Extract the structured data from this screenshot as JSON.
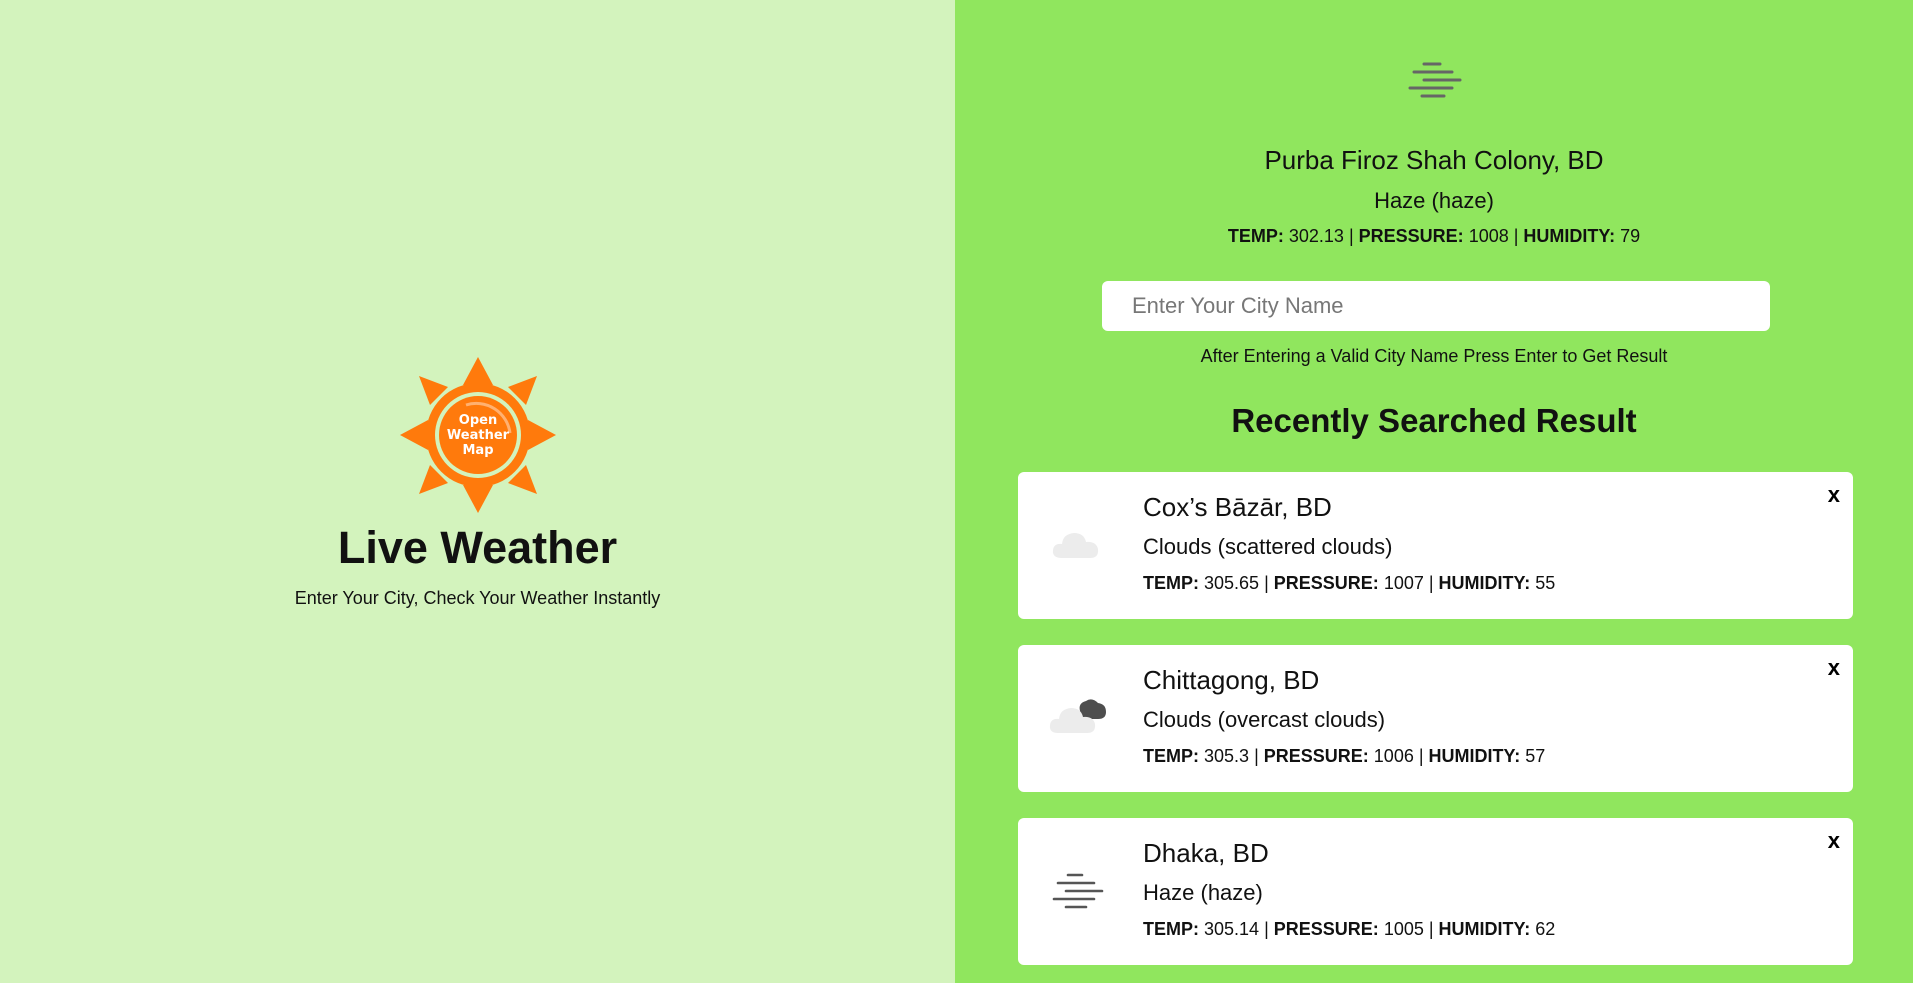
{
  "brand": {
    "logo_text": "Open Weather Map",
    "title": "Live Weather",
    "tagline": "Enter Your City, Check Your Weather Instantly"
  },
  "current": {
    "icon": "haze-icon",
    "city": "Purba Firoz Shah Colony, BD",
    "main": "Haze",
    "description": "haze",
    "temp": "302.13",
    "pressure": "1008",
    "humidity": "79"
  },
  "labels": {
    "temp": "TEMP:",
    "pressure": "PRESSURE:",
    "humidity": "HUMIDITY:",
    "sep": " | "
  },
  "search": {
    "placeholder": "Enter Your City Name",
    "value": "",
    "hint": "After Entering a Valid City Name Press Enter to Get Result"
  },
  "recent": {
    "title": "Recently Searched Result",
    "close_label": "x",
    "items": [
      {
        "icon": "scattered-clouds-icon",
        "city": "Cox’s Bāzār, BD",
        "main": "Clouds",
        "description": "scattered clouds",
        "temp": "305.65",
        "pressure": "1007",
        "humidity": "55"
      },
      {
        "icon": "overcast-clouds-icon",
        "city": "Chittagong, BD",
        "main": "Clouds",
        "description": "overcast clouds",
        "temp": "305.3",
        "pressure": "1006",
        "humidity": "57"
      },
      {
        "icon": "haze-icon",
        "city": "Dhaka, BD",
        "main": "Haze",
        "description": "haze",
        "temp": "305.14",
        "pressure": "1005",
        "humidity": "62"
      }
    ]
  },
  "colors": {
    "left_bg": "#d3f3bd",
    "right_bg": "#90e65e",
    "sun_orange": "#ff7a0c",
    "card_bg": "#ffffff"
  }
}
